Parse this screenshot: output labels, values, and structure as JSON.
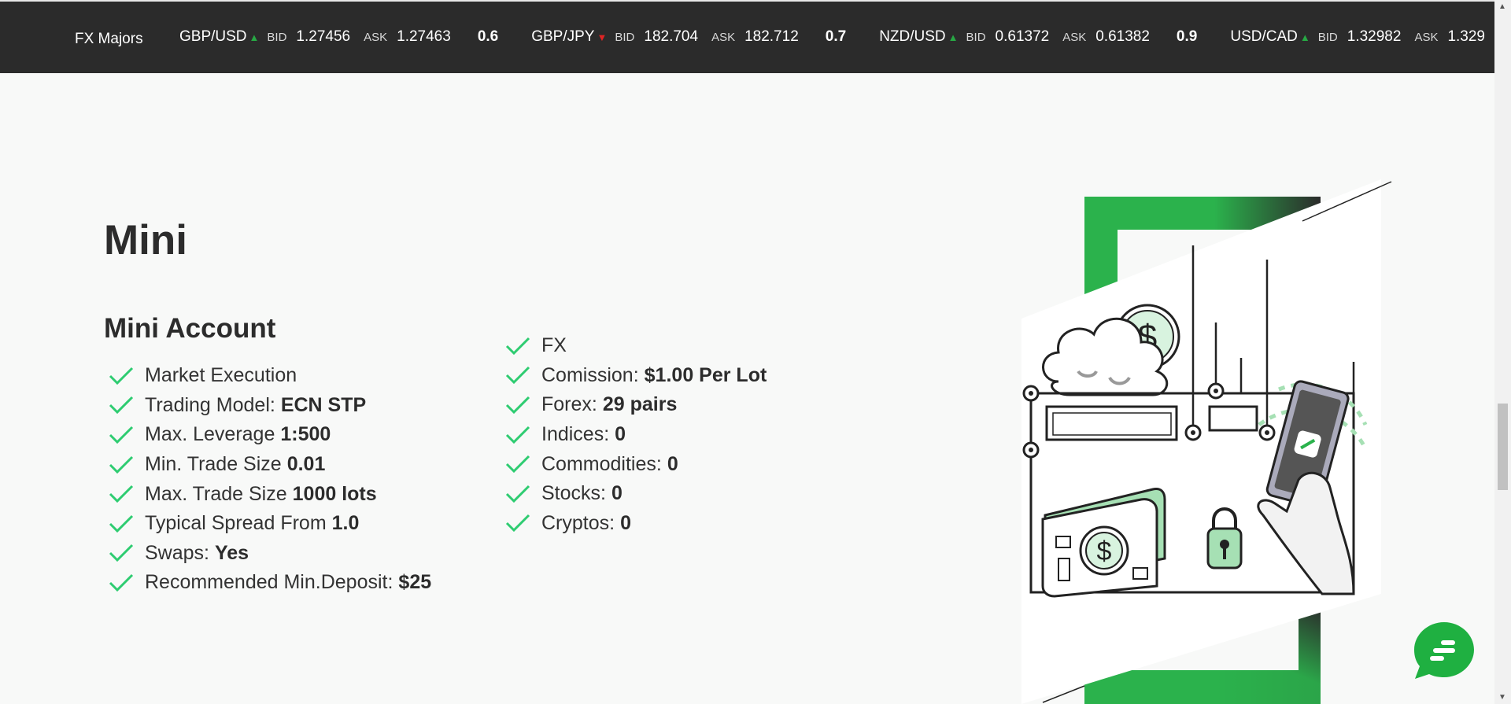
{
  "ticker": {
    "title": "FX Majors",
    "items": [
      {
        "pair": "GBP/USD",
        "direction": "up",
        "bid_label": "BID",
        "bid": "1.27456",
        "ask_label": "ASK",
        "ask": "1.27463",
        "spread": "0.6"
      },
      {
        "pair": "GBP/JPY",
        "direction": "down",
        "bid_label": "BID",
        "bid": "182.704",
        "ask_label": "ASK",
        "ask": "182.712",
        "spread": "0.7"
      },
      {
        "pair": "NZD/USD",
        "direction": "up",
        "bid_label": "BID",
        "bid": "0.61372",
        "ask_label": "ASK",
        "ask": "0.61382",
        "spread": "0.9"
      },
      {
        "pair": "USD/CAD",
        "direction": "up",
        "bid_label": "BID",
        "bid": "1.32982",
        "ask_label": "ASK",
        "ask": "1.329",
        "spread": ""
      }
    ],
    "up_color": "#27a844",
    "down_color": "#e02424"
  },
  "page": {
    "title": "Mini",
    "section_title": "Mini Account",
    "left_features": [
      {
        "label": "Market Execution",
        "value": ""
      },
      {
        "label": "Trading Model:",
        "value": "ECN STP"
      },
      {
        "label": "Max. Leverage",
        "value": "1:500"
      },
      {
        "label": "Min. Trade Size",
        "value": "0.01"
      },
      {
        "label": "Max. Trade Size",
        "value": "1000 lots"
      },
      {
        "label": "Typical Spread From",
        "value": "1.0"
      },
      {
        "label": "Swaps:",
        "value": "Yes"
      },
      {
        "label": "Recommended Min.Deposit:",
        "value": "$25"
      }
    ],
    "right_features": [
      {
        "label": "FX",
        "value": ""
      },
      {
        "label": "Comission:",
        "value": "$1.00 Per Lot"
      },
      {
        "label": "Forex:",
        "value": "29 pairs"
      },
      {
        "label": "Indices:",
        "value": "0"
      },
      {
        "label": "Commodities:",
        "value": "0"
      },
      {
        "label": "Stocks:",
        "value": "0"
      },
      {
        "label": "Cryptos:",
        "value": "0"
      }
    ],
    "check_color": "#2ecc71",
    "accent_color": "#2bb24c"
  },
  "icons": {
    "check": "check-icon",
    "chat": "chat-icon",
    "illustration": "wallet-phone-illustration"
  }
}
